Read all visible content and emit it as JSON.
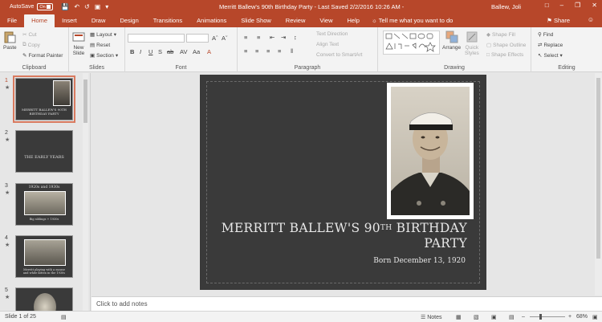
{
  "titlebar": {
    "autosave_label": "AutoSave",
    "autosave_state": "On",
    "doc_title": "Merritt Ballew's 90th Birthday Party  -  Last Saved 2/2/2016 10:26 AM  -",
    "user": "Ballew, Joli",
    "qat_icons": [
      "save-icon",
      "undo-icon",
      "redo-icon",
      "slideshow-icon",
      "customize-icon"
    ]
  },
  "tabs": [
    {
      "label": "File"
    },
    {
      "label": "Home"
    },
    {
      "label": "Insert"
    },
    {
      "label": "Draw"
    },
    {
      "label": "Design"
    },
    {
      "label": "Transitions"
    },
    {
      "label": "Animations"
    },
    {
      "label": "Slide Show"
    },
    {
      "label": "Review"
    },
    {
      "label": "View"
    },
    {
      "label": "Help"
    }
  ],
  "tellme": "Tell me what you want to do",
  "share": "Share",
  "ribbon": {
    "clipboard": {
      "label": "Clipboard",
      "paste": "Paste",
      "cut": "Cut",
      "copy": "Copy",
      "format_painter": "Format Painter"
    },
    "slides": {
      "label": "Slides",
      "new_slide": "New",
      "new_slide2": "Slide",
      "layout": "Layout",
      "reset": "Reset",
      "section": "Section"
    },
    "font": {
      "label": "Font"
    },
    "paragraph": {
      "label": "Paragraph",
      "text_direction": "Text Direction",
      "align_text": "Align Text",
      "smartart": "Convert to SmartArt"
    },
    "drawing": {
      "label": "Drawing",
      "arrange": "Arrange",
      "quick_styles": "Quick",
      "quick_styles2": "Styles",
      "shape_fill": "Shape Fill",
      "shape_outline": "Shape Outline",
      "shape_effects": "Shape Effects"
    },
    "editing": {
      "label": "Editing",
      "find": "Find",
      "replace": "Replace",
      "select": "Select"
    }
  },
  "thumbnails": [
    {
      "num": "1",
      "text": "MERRITT BALLEW'S 90TH BIRTHDAY PARTY",
      "selected": true
    },
    {
      "num": "2",
      "text": "THE EARLY YEARS"
    },
    {
      "num": "3",
      "text": "1920s and 1930s",
      "caption": "Big siblings + 1930s"
    },
    {
      "num": "4",
      "caption": "Merritt playing with a mouse and white kitten in the 1930s"
    },
    {
      "num": "5"
    }
  ],
  "slide": {
    "title_line1": "MERRITT BALLEW'S 90",
    "title_sup": "TH",
    "title_line1b": " BIRTHDAY",
    "title_line2": "PARTY",
    "subtitle": "Born December 13, 1920"
  },
  "notes_placeholder": "Click to add notes",
  "statusbar": {
    "slide_info": "Slide 1 of 25",
    "notes": "Notes",
    "zoom": "68%"
  },
  "colors": {
    "accent": "#b7472a",
    "slide_bg": "#3a3a3a"
  }
}
